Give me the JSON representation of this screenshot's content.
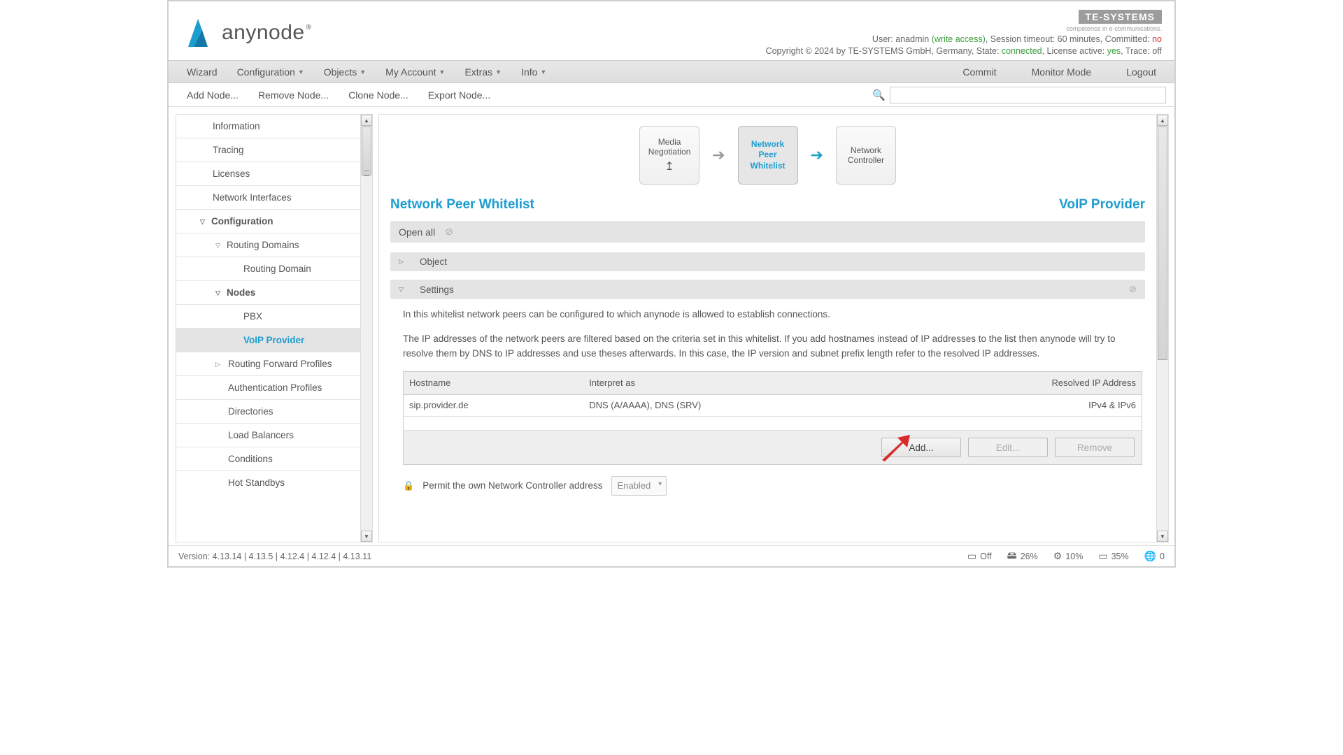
{
  "brand": {
    "name": "anynode",
    "vendor": "TE-SYSTEMS",
    "vendor_tag": "competence in e-communications."
  },
  "header": {
    "user_prefix": "User: ",
    "user": "anadmin",
    "access": "(write access)",
    "session": ", Session timeout: 60 minutes, Committed: ",
    "committed": "no",
    "copyright_prefix": "Copyright © 2024 by TE-SYSTEMS GmbH, Germany, State: ",
    "state": "connected",
    "license_prefix": ", License active: ",
    "license": "yes",
    "trace_prefix": ", Trace: ",
    "trace": "off"
  },
  "menu": {
    "wizard": "Wizard",
    "configuration": "Configuration",
    "objects": "Objects",
    "my_account": "My Account",
    "extras": "Extras",
    "info": "Info",
    "commit": "Commit",
    "monitor": "Monitor Mode",
    "logout": "Logout"
  },
  "toolbar": {
    "add": "Add Node...",
    "remove": "Remove Node...",
    "clone": "Clone Node...",
    "export": "Export Node...",
    "search_placeholder": ""
  },
  "sidebar": {
    "information": "Information",
    "tracing": "Tracing",
    "licenses": "Licenses",
    "network_interfaces": "Network Interfaces",
    "configuration": "Configuration",
    "routing_domains": "Routing Domains",
    "routing_domain": "Routing Domain",
    "nodes": "Nodes",
    "pbx": "PBX",
    "voip_provider": "VoIP Provider",
    "routing_forward": "Routing Forward Profiles",
    "auth_profiles": "Authentication Profiles",
    "directories": "Directories",
    "load_balancers": "Load Balancers",
    "conditions": "Conditions",
    "hot_standbys": "Hot Standbys"
  },
  "flow": {
    "media": "Media Negotiation",
    "npw": "Network Peer Whitelist",
    "nc": "Network Controller"
  },
  "page": {
    "title": "Network Peer Whitelist",
    "subtitle": "VoIP Provider",
    "open_all": "Open all",
    "object": "Object",
    "settings": "Settings"
  },
  "settings": {
    "p1": "In this whitelist network peers can be configured to which anynode is allowed to establish connections.",
    "p2": "The IP addresses of the network peers are filtered based on the criteria set in this whitelist. If you add hostnames instead of IP addresses to the list then anynode will try to resolve them by DNS to IP addresses and use theses afterwards. In this case, the IP version and subnet prefix length refer to the resolved IP addresses.",
    "col_host": "Hostname",
    "col_interpret": "Interpret as",
    "col_resolved": "Resolved IP Address",
    "row_host": "sip.provider.de",
    "row_interpret": "DNS (A/AAAA), DNS (SRV)",
    "row_resolved": "IPv4 & IPv6",
    "add": "Add...",
    "edit": "Edit...",
    "remove": "Remove",
    "permit_label": "Permit the own Network Controller address",
    "permit_value": "Enabled"
  },
  "status": {
    "versions": "Version: 4.13.14 | 4.13.5 | 4.12.4 | 4.12.4 | 4.13.11",
    "hw": "Off",
    "disk": "26%",
    "cpu": "10%",
    "mem": "35%",
    "net": "0"
  }
}
